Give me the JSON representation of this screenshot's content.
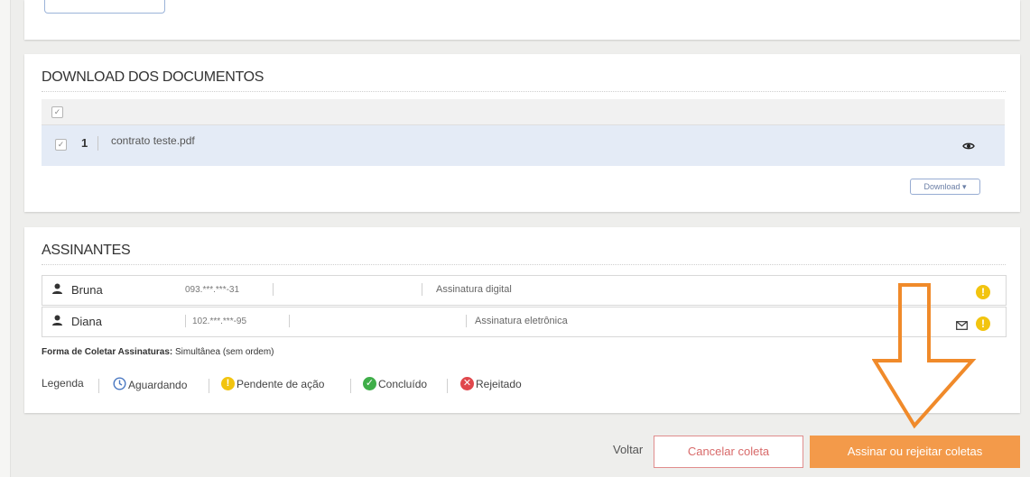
{
  "documents": {
    "title": "DOWNLOAD DOS DOCUMENTOS",
    "rows": [
      {
        "number": "1",
        "name": "contrato teste.pdf"
      }
    ],
    "download_label": "Download ▾"
  },
  "signers": {
    "title": "ASSINANTES",
    "rows": [
      {
        "name": "Bruna",
        "cpf": "093.***.***-31",
        "type": "Assinatura digital"
      },
      {
        "name": "Diana",
        "cpf": "102.***.***-95",
        "type": "Assinatura eletrônica"
      }
    ],
    "forma_label": "Forma de Coletar Assinaturas:",
    "forma_value": "Simultânea (sem ordem)"
  },
  "legend": {
    "label": "Legenda",
    "items": [
      {
        "label": "Aguardando",
        "icon": "clock-icon",
        "color": "#4a78c2"
      },
      {
        "label": "Pendente de ação",
        "icon": "exclamation-icon",
        "color": "#f2c40f"
      },
      {
        "label": "Concluído",
        "icon": "check-circle-icon",
        "color": "#3fae49"
      },
      {
        "label": "Rejeitado",
        "icon": "x-circle-icon",
        "color": "#e0474c"
      }
    ]
  },
  "actions": {
    "back_label": "Voltar",
    "cancel_label": "Cancelar coleta",
    "sign_label": "Assinar ou rejeitar coletas"
  },
  "colors": {
    "accent_orange": "#f39a4a",
    "cancel_red": "#d86a6a",
    "selected_row": "#e4ebf6",
    "annotation_arrow": "#f08a2a"
  }
}
